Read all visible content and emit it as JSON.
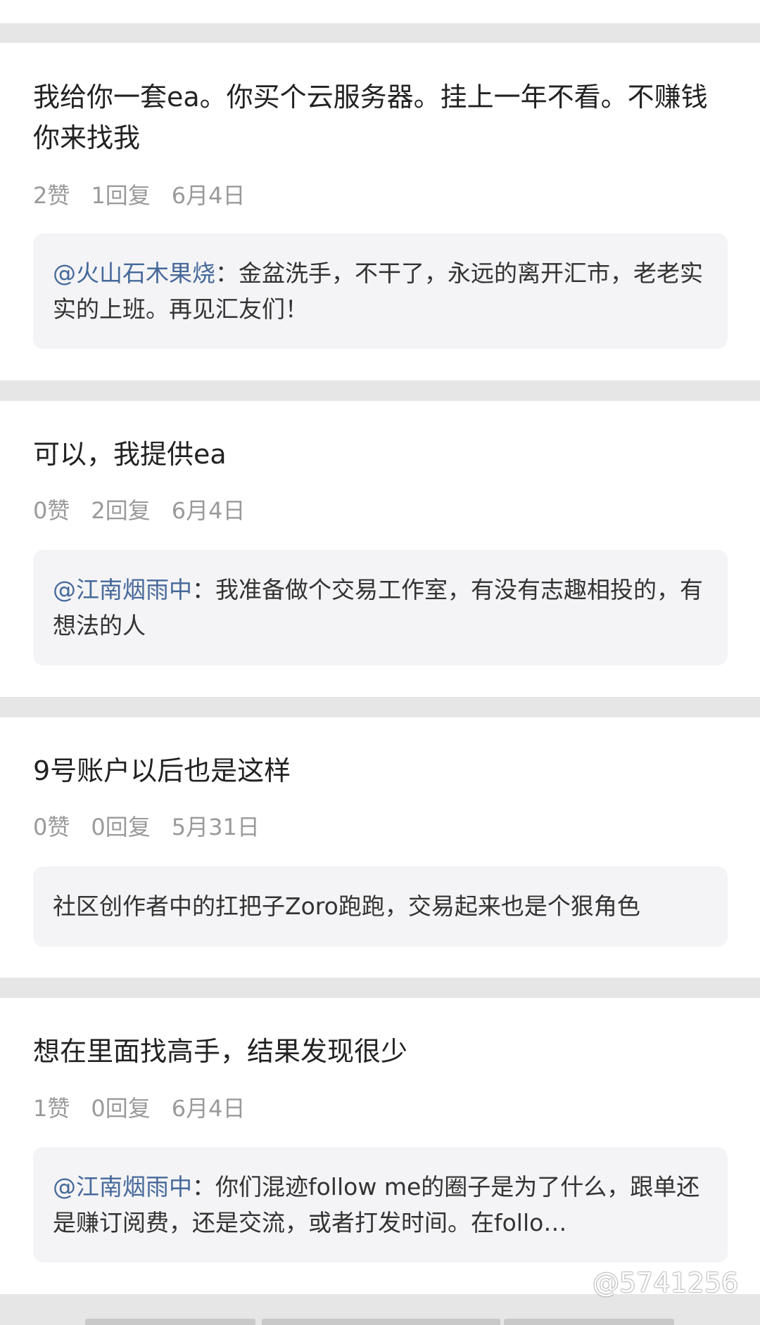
{
  "items": [
    {
      "reply": "我给你一套ea。你买个云服务器。挂上一年不看。不赚钱你来找我",
      "likes": "2赞",
      "replies": "1回复",
      "date": "6月4日",
      "quote_mention": "@火山石木果烧",
      "quote_text": "：金盆洗手，不干了，永远的离开汇市，老老实实的上班。再见汇友们！"
    },
    {
      "reply": "可以，我提供ea",
      "likes": "0赞",
      "replies": "2回复",
      "date": "6月4日",
      "quote_mention": "@江南烟雨中",
      "quote_text": "：我准备做个交易工作室，有没有志趣相投的，有想法的人"
    },
    {
      "reply": "9号账户以后也是这样",
      "likes": "0赞",
      "replies": "0回复",
      "date": "5月31日",
      "quote_mention": "",
      "quote_text": "社区创作者中的扛把子Zoro跑跑，交易起来也是个狠角色"
    },
    {
      "reply": "想在里面找高手，结果发现很少",
      "likes": "1赞",
      "replies": "0回复",
      "date": "6月4日",
      "quote_mention": "@江南烟雨中",
      "quote_text": "：你们混迹follow me的圈子是为了什么，跟单还是赚订阅费，还是交流，或者打发时间。在follo…"
    }
  ],
  "watermark": "@5741256",
  "colors": {
    "mention": "#46699a",
    "separator": "#e6e6e6",
    "quote_background": "#f4f4f6",
    "meta_text": "#9a9a9a"
  }
}
